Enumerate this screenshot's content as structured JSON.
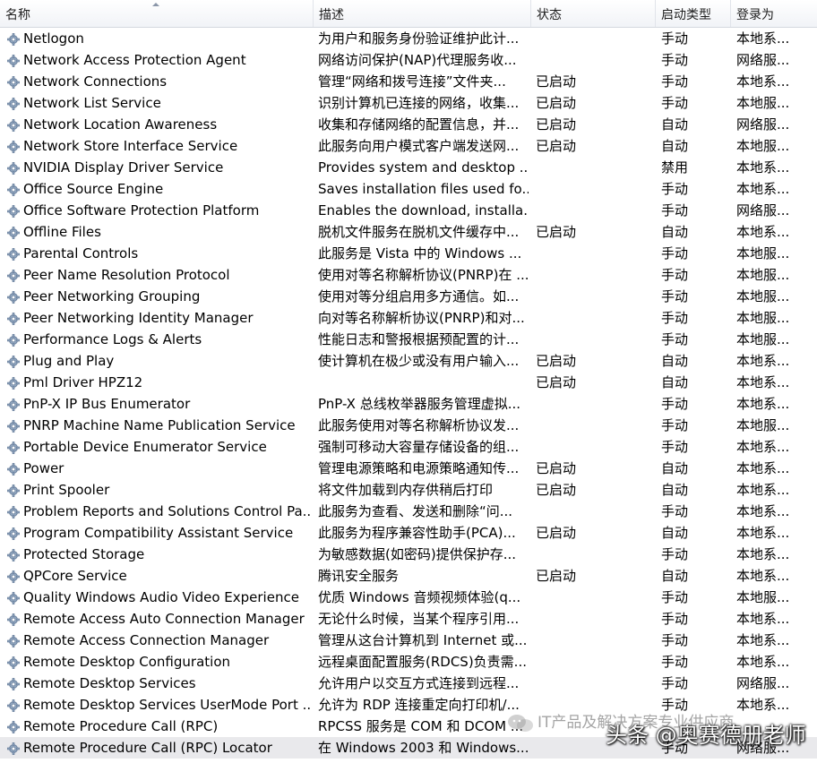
{
  "columns": {
    "name": "名称",
    "desc": "描述",
    "status": "状态",
    "startup": "启动类型",
    "logon": "登录为"
  },
  "icons": {
    "service": "gear-icon",
    "watermark": "wechat-icon"
  },
  "watermark": "IT产品及解决方案专业供应商",
  "toutiao": "头条 @奥赛德册老师",
  "services": [
    {
      "name": "Netlogon",
      "desc": "为用户和服务身份验证维护此计...",
      "status": "",
      "startup": "手动",
      "logon": "本地系..."
    },
    {
      "name": "Network Access Protection Agent",
      "desc": "网络访问保护(NAP)代理服务收...",
      "status": "",
      "startup": "手动",
      "logon": "网络服..."
    },
    {
      "name": "Network Connections",
      "desc": "管理“网络和拨号连接”文件夹...",
      "status": "已启动",
      "startup": "手动",
      "logon": "本地系..."
    },
    {
      "name": "Network List Service",
      "desc": "识别计算机已连接的网络，收集...",
      "status": "已启动",
      "startup": "手动",
      "logon": "本地服..."
    },
    {
      "name": "Network Location Awareness",
      "desc": "收集和存储网络的配置信息，并...",
      "status": "已启动",
      "startup": "自动",
      "logon": "网络服..."
    },
    {
      "name": "Network Store Interface Service",
      "desc": "此服务向用户模式客户端发送网...",
      "status": "已启动",
      "startup": "自动",
      "logon": "本地服..."
    },
    {
      "name": "NVIDIA Display Driver Service",
      "desc": "Provides system and desktop ...",
      "status": "",
      "startup": "禁用",
      "logon": "本地系..."
    },
    {
      "name": "Office  Source Engine",
      "desc": "Saves installation files used fo...",
      "status": "",
      "startup": "手动",
      "logon": "本地系..."
    },
    {
      "name": "Office Software Protection Platform",
      "desc": "Enables the download, installa...",
      "status": "",
      "startup": "手动",
      "logon": "网络服..."
    },
    {
      "name": "Offline Files",
      "desc": "脱机文件服务在脱机文件缓存中...",
      "status": "已启动",
      "startup": "自动",
      "logon": "本地系..."
    },
    {
      "name": "Parental Controls",
      "desc": "此服务是 Vista 中的 Windows ...",
      "status": "",
      "startup": "手动",
      "logon": "本地服..."
    },
    {
      "name": "Peer Name Resolution Protocol",
      "desc": "使用对等名称解析协议(PNRP)在 ...",
      "status": "",
      "startup": "手动",
      "logon": "本地服..."
    },
    {
      "name": "Peer Networking Grouping",
      "desc": "使用对等分组启用多方通信。如...",
      "status": "",
      "startup": "手动",
      "logon": "本地服..."
    },
    {
      "name": "Peer Networking Identity Manager",
      "desc": "向对等名称解析协议(PNRP)和对...",
      "status": "",
      "startup": "手动",
      "logon": "本地服..."
    },
    {
      "name": "Performance Logs & Alerts",
      "desc": "性能日志和警报根据预配置的计...",
      "status": "",
      "startup": "手动",
      "logon": "本地服..."
    },
    {
      "name": "Plug and Play",
      "desc": "使计算机在极少或没有用户输入...",
      "status": "已启动",
      "startup": "自动",
      "logon": "本地系..."
    },
    {
      "name": "Pml Driver HPZ12",
      "desc": "",
      "status": "已启动",
      "startup": "自动",
      "logon": "本地系..."
    },
    {
      "name": "PnP-X IP Bus Enumerator",
      "desc": "PnP-X 总线枚举器服务管理虚拟...",
      "status": "",
      "startup": "手动",
      "logon": "本地系..."
    },
    {
      "name": "PNRP Machine Name Publication Service",
      "desc": "此服务使用对等名称解析协议发...",
      "status": "",
      "startup": "手动",
      "logon": "本地服..."
    },
    {
      "name": "Portable Device Enumerator Service",
      "desc": "强制可移动大容量存储设备的组...",
      "status": "",
      "startup": "手动",
      "logon": "本地系..."
    },
    {
      "name": "Power",
      "desc": "管理电源策略和电源策略通知传...",
      "status": "已启动",
      "startup": "自动",
      "logon": "本地系..."
    },
    {
      "name": "Print Spooler",
      "desc": "将文件加载到内存供稍后打印",
      "status": "已启动",
      "startup": "自动",
      "logon": "本地系..."
    },
    {
      "name": "Problem Reports and Solutions Control Pa...",
      "desc": "此服务为查看、发送和删除“问...",
      "status": "",
      "startup": "手动",
      "logon": "本地系..."
    },
    {
      "name": "Program Compatibility Assistant Service",
      "desc": "此服务为程序兼容性助手(PCA)...",
      "status": "已启动",
      "startup": "自动",
      "logon": "本地系..."
    },
    {
      "name": "Protected Storage",
      "desc": "为敏感数据(如密码)提供保护存...",
      "status": "",
      "startup": "手动",
      "logon": "本地系..."
    },
    {
      "name": "QPCore Service",
      "desc": "腾讯安全服务",
      "status": "已启动",
      "startup": "自动",
      "logon": "本地系..."
    },
    {
      "name": "Quality Windows Audio Video Experience",
      "desc": "优质 Windows 音频视频体验(q...",
      "status": "",
      "startup": "手动",
      "logon": "本地服..."
    },
    {
      "name": "Remote Access Auto Connection Manager",
      "desc": "无论什么时候，当某个程序引用...",
      "status": "",
      "startup": "手动",
      "logon": "本地系..."
    },
    {
      "name": "Remote Access Connection Manager",
      "desc": "管理从这台计算机到 Internet 或...",
      "status": "",
      "startup": "手动",
      "logon": "本地系..."
    },
    {
      "name": "Remote Desktop Configuration",
      "desc": "远程桌面配置服务(RDCS)负责需...",
      "status": "",
      "startup": "手动",
      "logon": "本地系..."
    },
    {
      "name": "Remote Desktop Services",
      "desc": "允许用户以交互方式连接到远程...",
      "status": "",
      "startup": "手动",
      "logon": "网络服..."
    },
    {
      "name": "Remote Desktop Services UserMode Port ...",
      "desc": "允许为 RDP 连接重定向打印机/...",
      "status": "",
      "startup": "手动",
      "logon": "本地系..."
    },
    {
      "name": "Remote Procedure Call (RPC)",
      "desc": "RPCSS 服务是 COM 和 DCOM ...",
      "status": "",
      "startup": "",
      "logon": ""
    },
    {
      "name": "Remote Procedure Call (RPC) Locator",
      "desc": "在 Windows 2003 和 Windows...",
      "status": "",
      "startup": "手动",
      "logon": "网络服..."
    }
  ]
}
